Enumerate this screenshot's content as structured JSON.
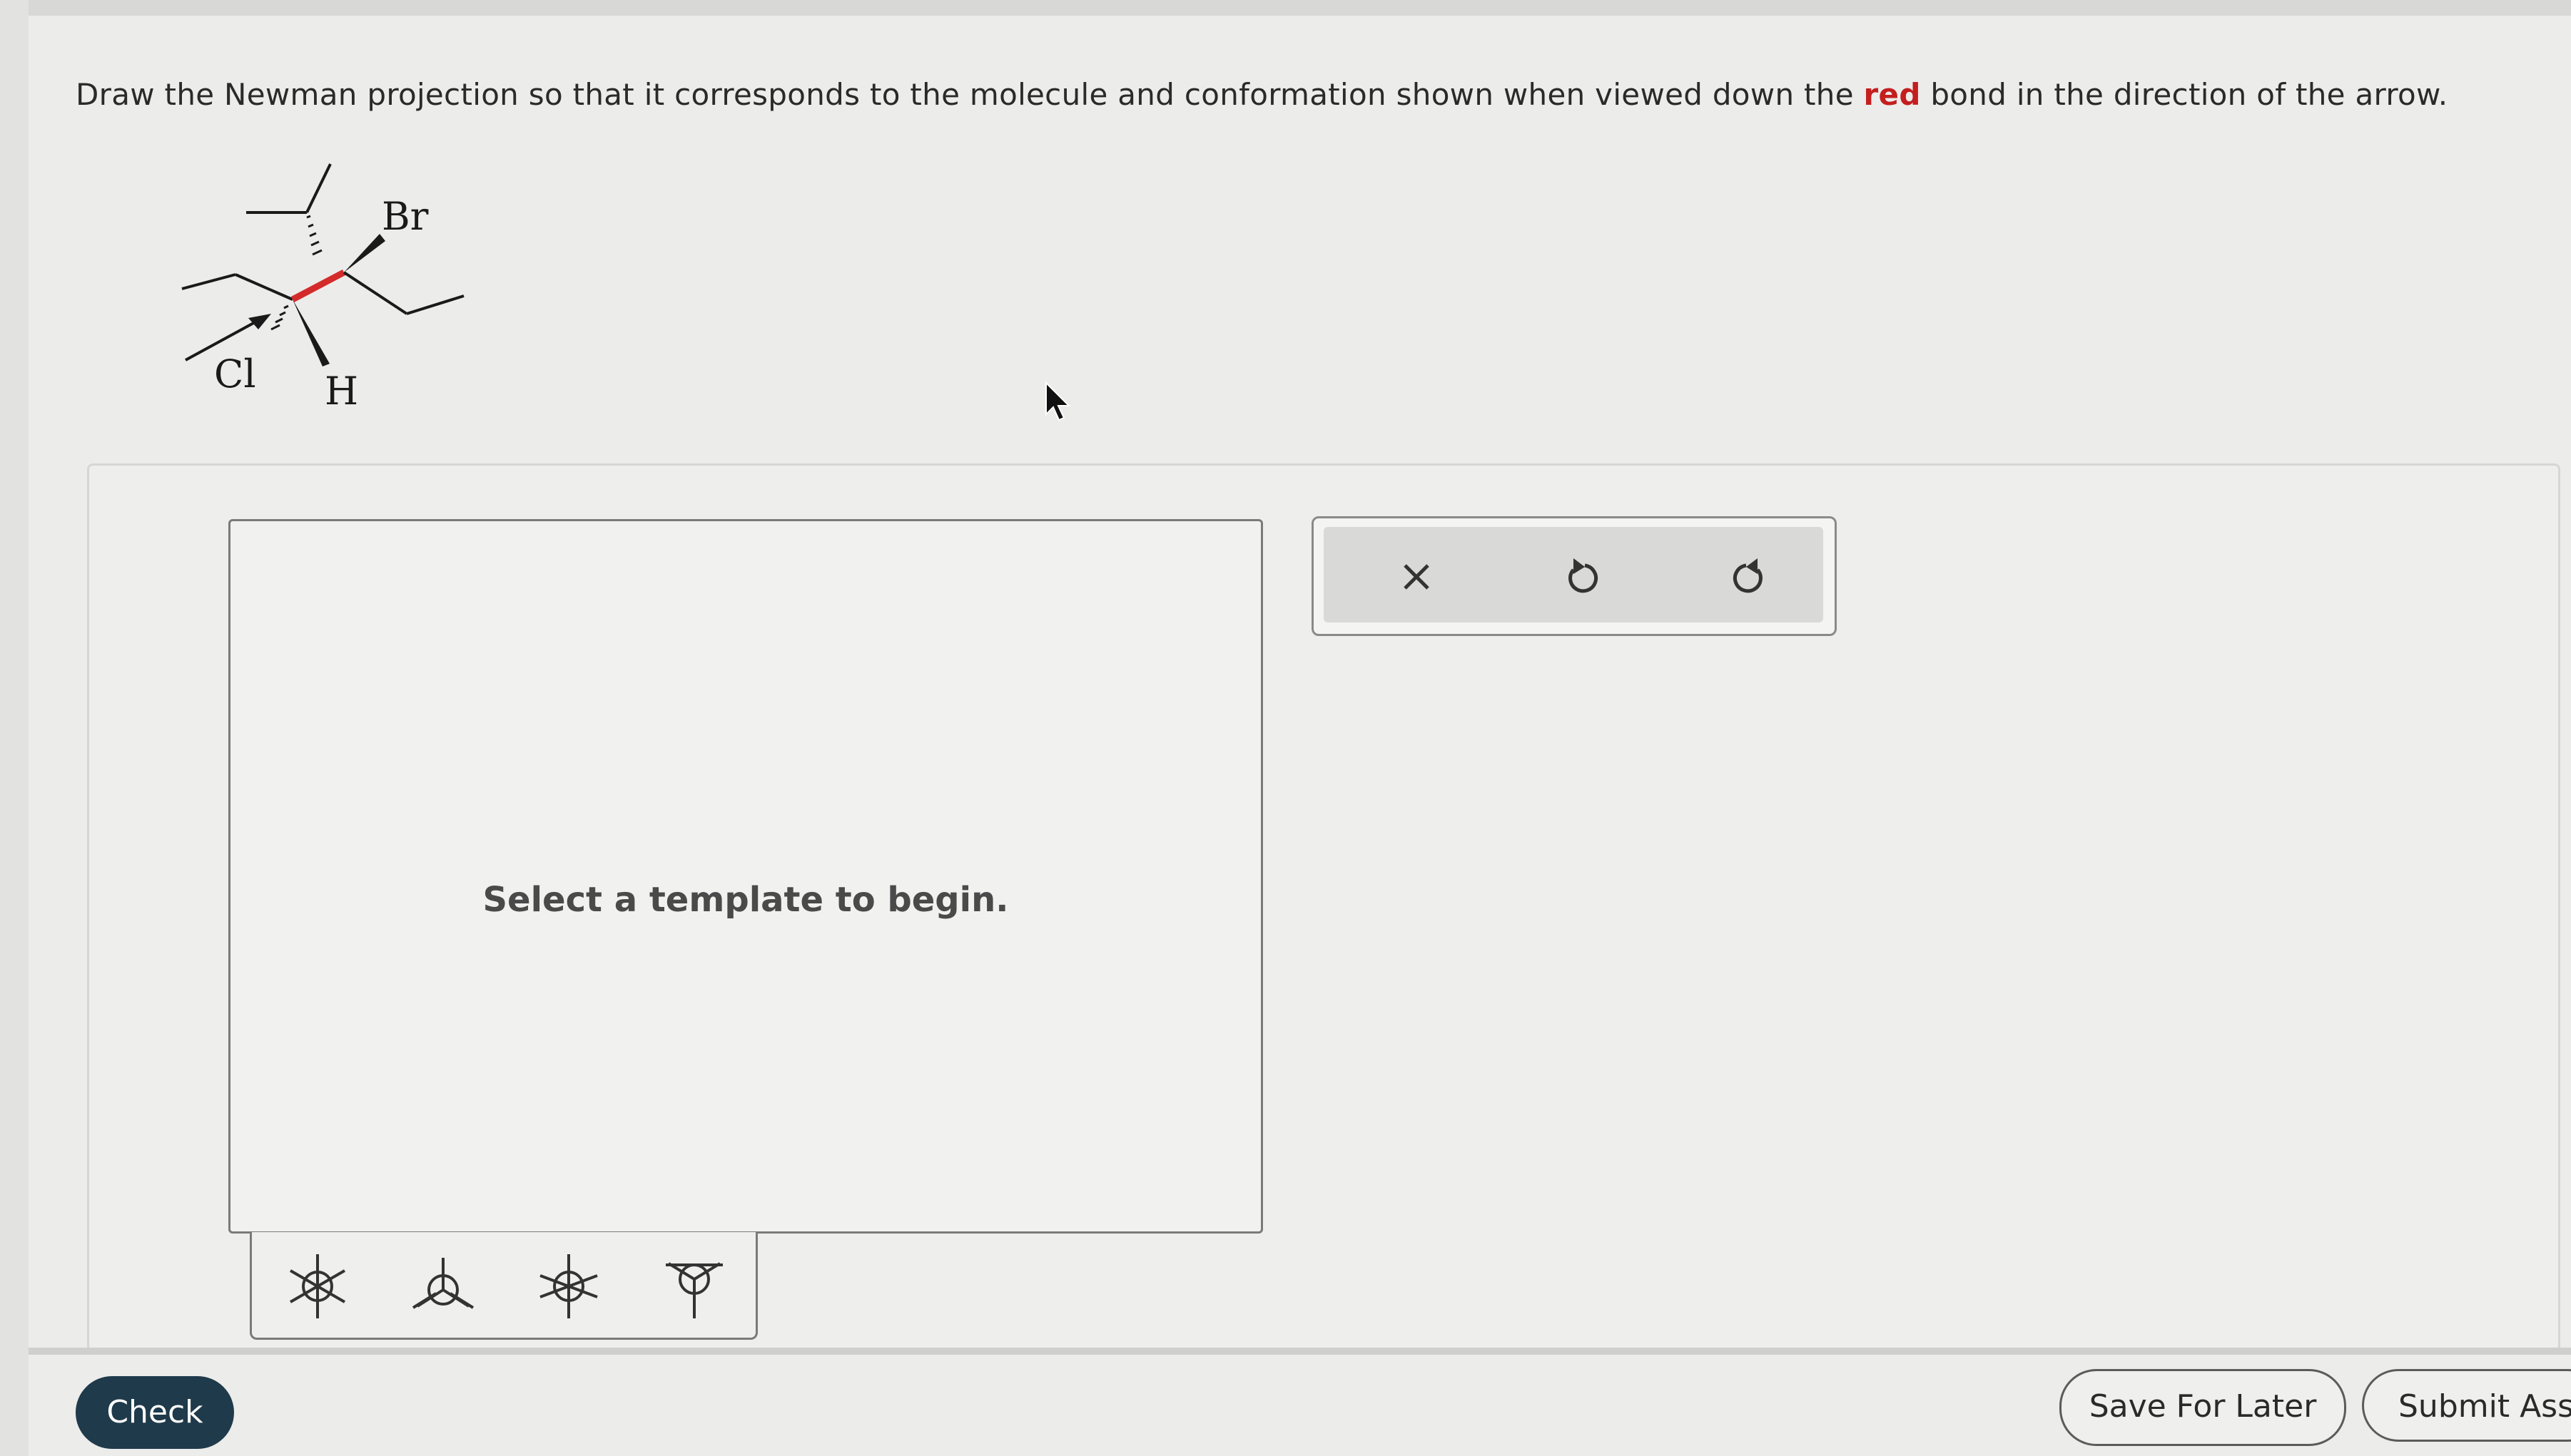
{
  "question": {
    "before": "Draw the Newman projection so that it corresponds to the molecule and conformation shown when viewed down the ",
    "highlight": "red",
    "after": " bond in the direction of the arrow."
  },
  "molecule": {
    "labels": {
      "br": "Br",
      "cl": "Cl",
      "h": "H"
    },
    "colors": {
      "bond": "#1a1a1a",
      "highlight_bond": "#d42a2a"
    }
  },
  "canvas": {
    "message": "Select a template to begin."
  },
  "templates": [
    {
      "icon": "newman-staggered-template-icon"
    },
    {
      "icon": "newman-eclipsed-template-icon"
    },
    {
      "icon": "newman-staggered-alt-template-icon"
    },
    {
      "icon": "newman-partial-template-icon"
    }
  ],
  "toolbar": {
    "clear_icon": "close-icon",
    "undo_icon": "undo-icon",
    "redo_icon": "redo-icon"
  },
  "footer": {
    "check_label": "Check",
    "save_label": "Save For Later",
    "submit_label": "Submit Assi"
  }
}
